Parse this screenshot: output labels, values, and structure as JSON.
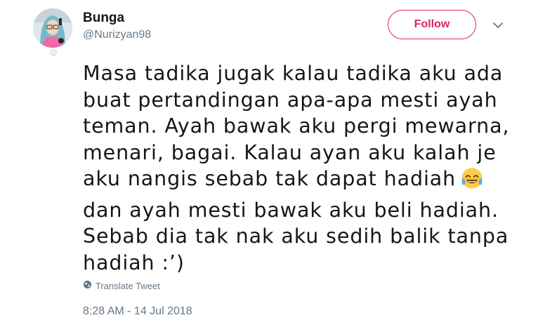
{
  "user": {
    "display_name": "Bunga",
    "handle": "@Nurizyan98"
  },
  "actions": {
    "follow_label": "Follow",
    "more_icon": "chevron-down-icon"
  },
  "tweet": {
    "lines": [
      "Masa tadika jugak kalau tadika aku ada",
      "buat pertandingan apa-apa mesti ayah",
      "teman. Ayah bawak aku pergi mewarna,",
      "menari, bagai. Kalau ayan aku kalah je",
      "aku nangis sebab tak dapat hadiah",
      "dan ayah mesti bawak aku beli hadiah.",
      "Sebab dia tak nak aku sedih balik tanpa",
      "hadiah :’)"
    ],
    "emoji": "tears-of-joy-emoji",
    "translate_label": "Translate Tweet",
    "translate_icon": "globe-icon",
    "timestamp": "8:28 AM - 14 Jul 2018"
  },
  "colors": {
    "accent": "#e0245e",
    "secondary_text": "#657786",
    "primary_text": "#14171a"
  }
}
